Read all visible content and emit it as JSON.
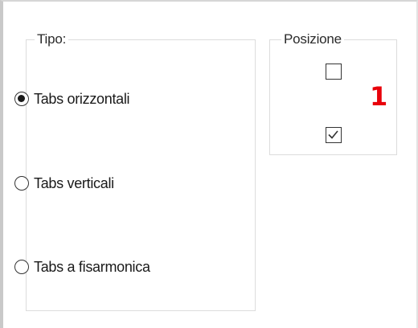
{
  "tipo": {
    "legend": "Tipo:",
    "options": [
      {
        "label": "Tabs orizzontali",
        "selected": true
      },
      {
        "label": "Tabs verticali",
        "selected": false
      },
      {
        "label": "Tabs a fisarmonica",
        "selected": false
      }
    ]
  },
  "posizione": {
    "legend": "Posizione",
    "checkboxes": [
      {
        "checked": false
      },
      {
        "checked": true
      }
    ]
  },
  "annotation": {
    "number": "1",
    "color": "#e8000a"
  }
}
